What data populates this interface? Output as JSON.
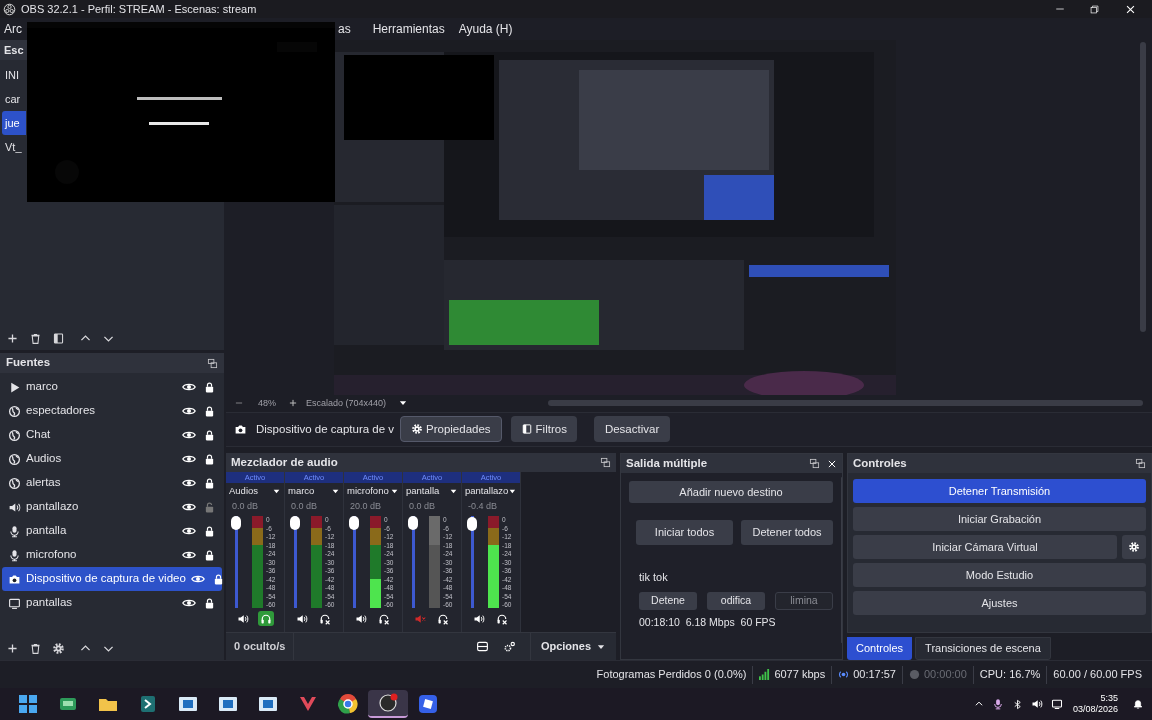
{
  "window": {
    "title": "OBS 32.2.1 - Perfil: STREAM - Escenas: stream"
  },
  "menu": [
    {
      "label": "Arc"
    },
    {
      "label": "as"
    },
    {
      "label": "Herramientas"
    },
    {
      "label": "Ayuda (H)"
    }
  ],
  "scenes": {
    "title": "Esc",
    "items": [
      {
        "label": "INI",
        "selected": false
      },
      {
        "label": "car",
        "selected": false
      },
      {
        "label": "jue",
        "selected": true
      },
      {
        "label": "Vt_",
        "selected": false
      }
    ]
  },
  "preview": {
    "zoom": "48%",
    "scaling": "Escalado (704x440)"
  },
  "source_toolbar": {
    "source": "Dispositivo de captura de v",
    "buttons": [
      {
        "label": "Propiedades"
      },
      {
        "label": "Filtros"
      },
      {
        "label": "Desactivar"
      }
    ]
  },
  "sources": {
    "title": "Fuentes",
    "items": [
      {
        "label": "marco",
        "kind": "media",
        "visible": true,
        "locked": true,
        "selected": false
      },
      {
        "label": "espectadores",
        "kind": "browser",
        "visible": true,
        "locked": true,
        "selected": false
      },
      {
        "label": "Chat",
        "kind": "browser",
        "visible": true,
        "locked": true,
        "selected": false
      },
      {
        "label": "Audios",
        "kind": "browser",
        "visible": true,
        "locked": true,
        "selected": false
      },
      {
        "label": "alertas",
        "kind": "browser",
        "visible": true,
        "locked": true,
        "selected": false
      },
      {
        "label": "pantallazo",
        "kind": "speaker",
        "visible": true,
        "locked": false,
        "selected": false
      },
      {
        "label": "pantalla",
        "kind": "mic",
        "visible": true,
        "locked": true,
        "selected": false
      },
      {
        "label": "microfono",
        "kind": "mic",
        "visible": true,
        "locked": true,
        "selected": false
      },
      {
        "label": "Dispositivo de captura de video",
        "kind": "camera",
        "visible": true,
        "locked": true,
        "selected": true
      },
      {
        "label": "pantallas",
        "kind": "display",
        "visible": true,
        "locked": true,
        "selected": false
      }
    ]
  },
  "mixer": {
    "title": "Mezclador de audio",
    "hidden": "0 oculto/s",
    "options": "Opciones",
    "channels": [
      {
        "status": "Activo",
        "name": "Audios",
        "db": "0.0 dB",
        "level": 1,
        "muted": false,
        "monitor": true,
        "ticks": [
          "0",
          "-6",
          "-12",
          "-18",
          "-24",
          "-30",
          "-36",
          "-42",
          "-48",
          "-54",
          "-60"
        ]
      },
      {
        "status": "Activo",
        "name": "marco",
        "db": "0.0 dB",
        "level": 1,
        "muted": false,
        "monitor": false,
        "ticks": [
          "0",
          "-6",
          "-12",
          "-18",
          "-24",
          "-30",
          "-36",
          "-42",
          "-48",
          "-54",
          "-60"
        ]
      },
      {
        "status": "Activo",
        "name": "microfono",
        "db": "20.0 dB",
        "level": 1,
        "meter": {
          "level": 0.32
        },
        "muted": false,
        "monitor": false,
        "ticks": [
          "0",
          "-6",
          "-12",
          "-18",
          "-24",
          "-30",
          "-36",
          "-42",
          "-48",
          "-54",
          "-60"
        ]
      },
      {
        "status": "Activo",
        "name": "pantalla",
        "db": "0.0 dB",
        "level": 1,
        "muted": true,
        "monitor": false,
        "ticks": [
          "0",
          "-6",
          "-12",
          "-18",
          "-24",
          "-30",
          "-36",
          "-42",
          "-48",
          "-54",
          "-60"
        ]
      },
      {
        "status": "Activo",
        "name": "pantallazo",
        "db": "-0.4 dB",
        "level": 0.99,
        "meter": {
          "level": 0.68
        },
        "muted": false,
        "monitor": false,
        "ticks": [
          "0",
          "-6",
          "-12",
          "-18",
          "-24",
          "-30",
          "-36",
          "-42",
          "-48",
          "-54",
          "-60"
        ]
      }
    ]
  },
  "multi_output": {
    "title": "Salida múltiple",
    "add": "Añadir nuevo destino",
    "start_all": "Iniciar todos",
    "stop_all": "Detener todos",
    "targets": [
      {
        "name": "tik tok",
        "stats": "00:18:10  6.18 Mbps  60 FPS",
        "buttons": [
          {
            "label": "Detene",
            "disabled": false
          },
          {
            "label": "odifica",
            "disabled": false
          },
          {
            "label": "limina",
            "disabled": true
          }
        ]
      }
    ]
  },
  "controls": {
    "title": "Controles",
    "buttons": [
      {
        "label": "Detener Transmisión",
        "active": true,
        "settings": false
      },
      {
        "label": "Iniciar Grabación",
        "active": false,
        "settings": false
      },
      {
        "label": "Iniciar Cámara Virtual",
        "active": false,
        "settings": true
      },
      {
        "label": "Modo Estudio",
        "active": false,
        "settings": false
      },
      {
        "label": "Ajustes",
        "active": false,
        "settings": false
      }
    ],
    "tabs": [
      {
        "label": "Controles",
        "selected": true
      },
      {
        "label": "Transiciones de escena",
        "selected": false
      }
    ]
  },
  "status_bar": {
    "dropped": "Fotogramas Perdidos 0 (0.0%)",
    "bitrate": "6077 kbps",
    "stream_time": "00:17:57",
    "record_time": "00:00:00",
    "cpu": "CPU: 16.7%",
    "fps": "60.00 / 60.00 FPS"
  },
  "taskbar": {
    "time": "5:35",
    "date": "03/08/2026"
  }
}
